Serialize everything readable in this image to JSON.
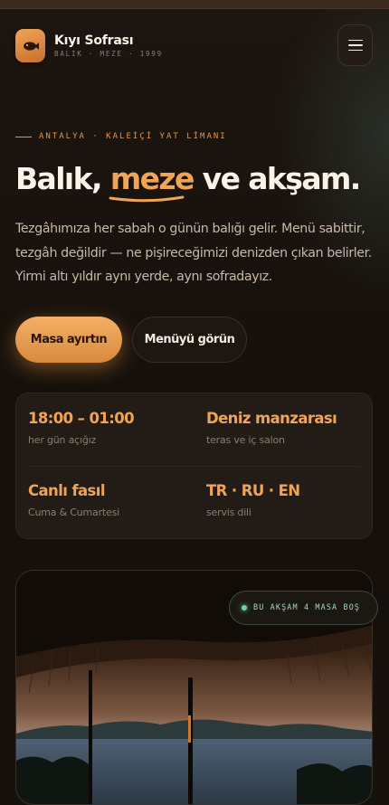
{
  "brand": {
    "name": "Kıyı Sofrası",
    "tagline": "BALIK · MEZE · 1999",
    "logo_icon": "fish-icon"
  },
  "header": {
    "menu_icon": "hamburger-icon"
  },
  "hero": {
    "kicker": "ANTALYA · KALEİÇİ YAT LİMANI",
    "headline_part1": "Balık, ",
    "headline_highlight": "meze",
    "headline_part2": " ve akşam.",
    "lead": "Tezgâhımıza her sabah o günün balığı gelir. Menü sabittir, tezgâh değildir — ne pişireceğimizi denizden çıkan belirler. Yirmi altı yıldır aynı yerde, aynı sofradayız."
  },
  "actions": {
    "primary": "Masa ayırtın",
    "secondary": "Menüyü görün"
  },
  "info": [
    {
      "title": "18:00 – 01:00",
      "sub": "her gün açığız"
    },
    {
      "title": "Deniz manzarası",
      "sub": "teras ve iç salon"
    },
    {
      "title": "Canlı fasıl",
      "sub": "Cuma & Cumartesi"
    },
    {
      "title": "TR · RU · EN",
      "sub": "servis dili"
    }
  ],
  "status": {
    "text": "BU AKŞAM 4 MASA BOŞ"
  },
  "colors": {
    "accent": "#f0a458",
    "background": "#17110c",
    "status": "#6fd6a2"
  }
}
